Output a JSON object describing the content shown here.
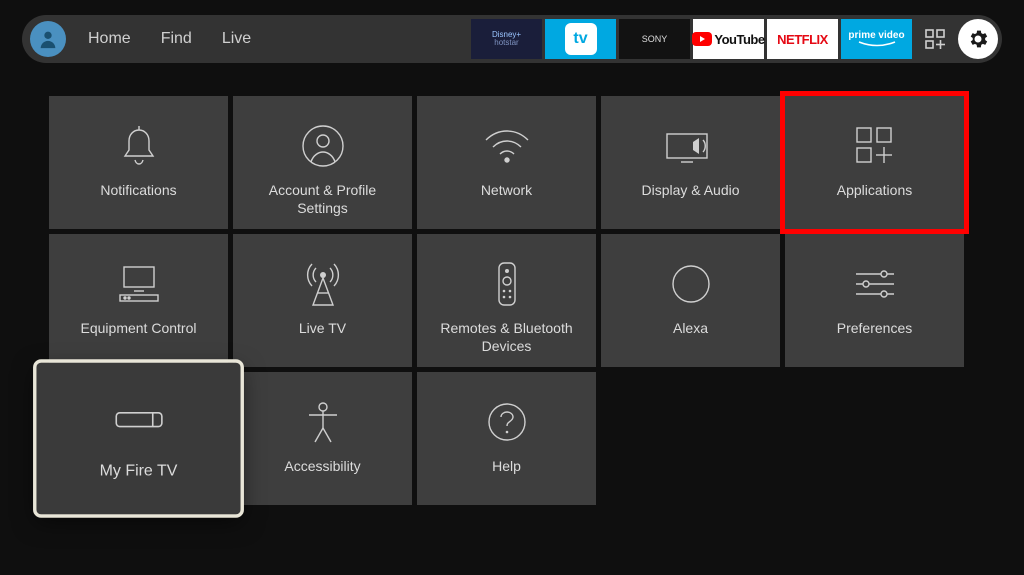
{
  "nav": {
    "links": [
      {
        "label": "Home"
      },
      {
        "label": "Find"
      },
      {
        "label": "Live"
      }
    ],
    "app_tiles": [
      {
        "name": "hotstar",
        "label": "Disney+ hotstar"
      },
      {
        "name": "tv",
        "label": "tv"
      },
      {
        "name": "sonyliv",
        "label": "SONY LIV"
      },
      {
        "name": "youtube",
        "label": "YouTube"
      },
      {
        "name": "netflix",
        "label": "NETFLIX"
      },
      {
        "name": "primevideo",
        "label": "prime video"
      }
    ]
  },
  "grid": {
    "tiles": [
      {
        "id": "notifications",
        "label": "Notifications"
      },
      {
        "id": "account",
        "label": "Account & Profile Settings"
      },
      {
        "id": "network",
        "label": "Network"
      },
      {
        "id": "display-audio",
        "label": "Display & Audio"
      },
      {
        "id": "applications",
        "label": "Applications",
        "highlighted": true
      },
      {
        "id": "equipment",
        "label": "Equipment Control"
      },
      {
        "id": "live-tv",
        "label": "Live TV"
      },
      {
        "id": "remotes",
        "label": "Remotes & Bluetooth Devices"
      },
      {
        "id": "alexa",
        "label": "Alexa"
      },
      {
        "id": "preferences",
        "label": "Preferences"
      },
      {
        "id": "my-fire-tv",
        "label": "My Fire TV",
        "selected": true
      },
      {
        "id": "accessibility",
        "label": "Accessibility"
      },
      {
        "id": "help",
        "label": "Help"
      }
    ]
  }
}
